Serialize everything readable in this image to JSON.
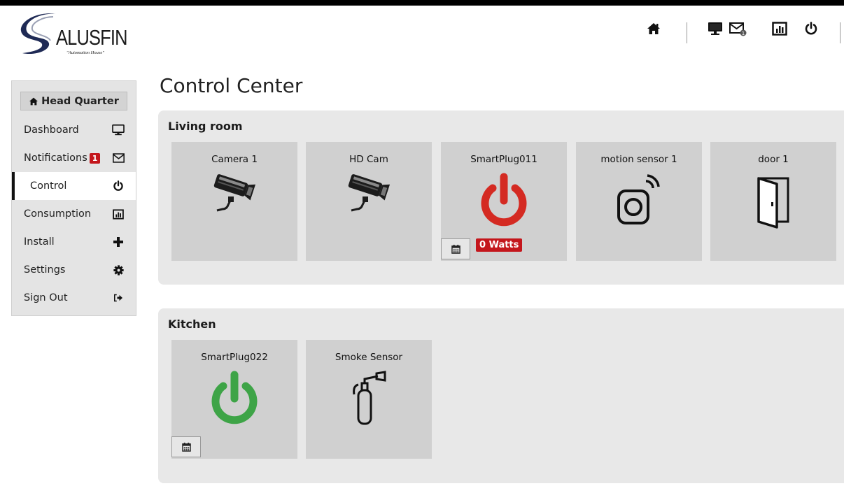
{
  "logo": {
    "text": "ALUSFIN",
    "tagline": "\"Automation House\""
  },
  "header": {
    "icons": [
      "home-icon",
      "desktop-icon",
      "envelope-icon",
      "bar-chart-icon",
      "power-icon"
    ],
    "mail_badge": "1"
  },
  "sidebar": {
    "heading": "Head Quarter",
    "items": [
      {
        "label": "Dashboard",
        "icon": "desktop-icon"
      },
      {
        "label": "Notifications",
        "icon": "envelope-icon",
        "badge": "1"
      },
      {
        "label": "Control",
        "icon": "power-icon",
        "active": true
      },
      {
        "label": "Consumption",
        "icon": "bar-chart-icon"
      },
      {
        "label": "Install",
        "icon": "plus-icon"
      },
      {
        "label": "Settings",
        "icon": "gear-icon"
      },
      {
        "label": "Sign Out",
        "icon": "sign-out-icon"
      }
    ]
  },
  "main": {
    "title": "Control Center",
    "rooms": [
      {
        "name": "Living room",
        "devices": [
          {
            "label": "Camera 1",
            "icon": "camera-icon"
          },
          {
            "label": "HD Cam",
            "icon": "camera-icon"
          },
          {
            "label": "SmartPlug011",
            "icon": "power-icon",
            "state": "off",
            "state_color": "#d42a22",
            "watts": "0 Watts"
          },
          {
            "label": "motion sensor 1",
            "icon": "motion-sensor-icon"
          },
          {
            "label": "door 1",
            "icon": "door-icon"
          }
        ]
      },
      {
        "name": "Kitchen",
        "devices": [
          {
            "label": "SmartPlug022",
            "icon": "power-icon",
            "state": "on",
            "state_color": "#3ea447"
          },
          {
            "label": "Smoke Sensor",
            "icon": "fire-extinguisher-icon"
          }
        ]
      }
    ]
  },
  "colors": {
    "badge": "#c4161c",
    "power_off": "#d42a22",
    "power_on": "#3ea447",
    "panel_bg": "#e8e8e8",
    "tile_bg": "#d0d0d0"
  }
}
